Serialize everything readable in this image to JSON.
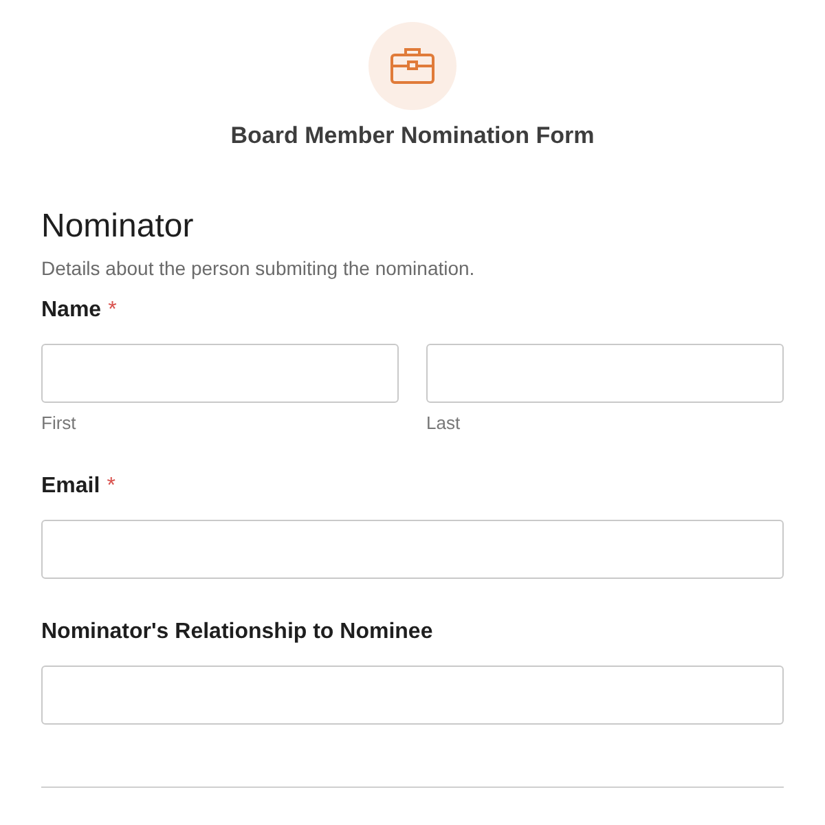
{
  "form": {
    "title": "Board Member Nomination Form"
  },
  "section": {
    "heading": "Nominator",
    "description": "Details about the person submiting the nomination."
  },
  "fields": [
    {
      "kind": "name",
      "label": "Name",
      "required_mark": "*",
      "subfields": [
        {
          "sublabel": "First"
        },
        {
          "sublabel": "Last"
        }
      ]
    },
    {
      "kind": "text",
      "label": "Email",
      "required_mark": "*"
    },
    {
      "kind": "text",
      "label": "Nominator's Relationship to Nominee"
    }
  ]
}
